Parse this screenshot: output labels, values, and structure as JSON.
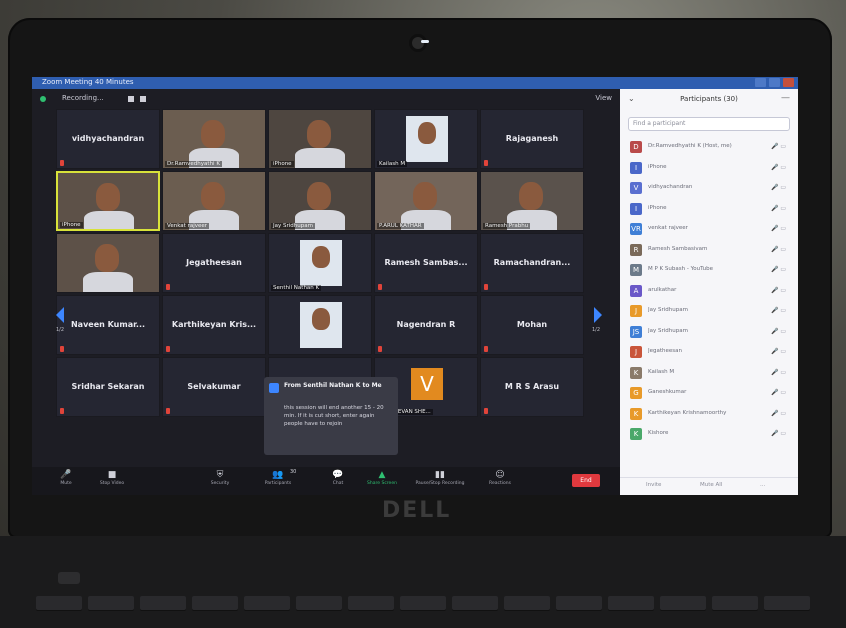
{
  "window": {
    "title": "Zoom Meeting 40 Minutes"
  },
  "recording": {
    "label": "Recording..."
  },
  "view": {
    "label": "View"
  },
  "tiles": [
    {
      "name": "vidhyachandran",
      "type": "name"
    },
    {
      "name": "Dr.Ramvedhyathi K",
      "type": "video"
    },
    {
      "name": "iPhone",
      "type": "video"
    },
    {
      "name": "Kailash M",
      "type": "photo"
    },
    {
      "name": "Rajaganesh",
      "type": "name"
    },
    {
      "name": "iPhone",
      "type": "video"
    },
    {
      "name": "Venkat rajveer",
      "type": "video"
    },
    {
      "name": "Jay Sridhupam",
      "type": "video"
    },
    {
      "name": "P.ARUL KATHAR",
      "type": "video"
    },
    {
      "name": "Ramesh Prabhu",
      "type": "video"
    },
    {
      "name": "",
      "type": "video"
    },
    {
      "name": "Jegatheesan",
      "type": "name"
    },
    {
      "name": "Senthil Nathan K",
      "type": "photo"
    },
    {
      "name": "Ramesh Sambas...",
      "type": "name"
    },
    {
      "name": "Ramachandran...",
      "type": "name"
    },
    {
      "name": "Naveen Kumar...",
      "type": "name"
    },
    {
      "name": "Karthikeyan Kris...",
      "type": "name"
    },
    {
      "name": "",
      "type": "photo"
    },
    {
      "name": "Nagendran R",
      "type": "name"
    },
    {
      "name": "Mohan",
      "type": "name"
    },
    {
      "name": "Sridhar Sekaran",
      "type": "name"
    },
    {
      "name": "Selvakumar",
      "type": "name"
    },
    {
      "name": "",
      "type": "empty"
    },
    {
      "name": "VASUDEVAN SHE...",
      "type": "avatar",
      "initial": "V"
    },
    {
      "name": "M R S Arasu",
      "type": "name"
    }
  ],
  "pages": {
    "left": "1/2",
    "right": "1/2"
  },
  "chat": {
    "sender": "From Senthil Nathan K to Me",
    "message": "this session will end another 15 - 20 min. If it is cut short, enter again people have to rejoin"
  },
  "toolbar": {
    "mute": "Mute",
    "stop_video": "Stop Video",
    "security": "Security",
    "participants": "Participants",
    "participants_count": "30",
    "chat": "Chat",
    "share_screen": "Share Screen",
    "pause_recording": "Pause/Stop Recording",
    "reactions": "Reactions",
    "end": "End"
  },
  "panel": {
    "title": "Participants (30)",
    "search_placeholder": "Find a participant",
    "participants": [
      {
        "name": "Dr.Ramvedhyathi K (Host, me)",
        "initial": "D",
        "color": "#b94a4a"
      },
      {
        "name": "iPhone",
        "initial": "I",
        "color": "#4a67c9"
      },
      {
        "name": "vidhyachandran",
        "initial": "V",
        "color": "#5a6fd0"
      },
      {
        "name": "iPhone",
        "initial": "I",
        "color": "#4a67c9"
      },
      {
        "name": "venkat rajveer",
        "initial": "VR",
        "color": "#3f7fd6"
      },
      {
        "name": "Ramesh Sambasivam",
        "initial": "R",
        "color": "#7a6a5a"
      },
      {
        "name": "M P K Subash - YouTube",
        "initial": "M",
        "color": "#6c7a8a"
      },
      {
        "name": "arulkathar",
        "initial": "A",
        "color": "#6a58c8"
      },
      {
        "name": "Jay Sridhupam",
        "initial": "J",
        "color": "#e89a2a"
      },
      {
        "name": "Jay Sridhupam",
        "initial": "JS",
        "color": "#3f7fd6"
      },
      {
        "name": "Jegatheesan",
        "initial": "J",
        "color": "#c9553a"
      },
      {
        "name": "Kailash M",
        "initial": "K",
        "color": "#8a7a6a"
      },
      {
        "name": "Ganeshkumar",
        "initial": "G",
        "color": "#e89a2a"
      },
      {
        "name": "Karthikeyan Krishnamoorthy",
        "initial": "K",
        "color": "#e89a2a"
      },
      {
        "name": "Kishore",
        "initial": "K",
        "color": "#4aa86a"
      }
    ],
    "footer": {
      "invite": "Invite",
      "mute_all": "Mute All",
      "more": "..."
    }
  },
  "branding": {
    "laptop": "DELL"
  }
}
